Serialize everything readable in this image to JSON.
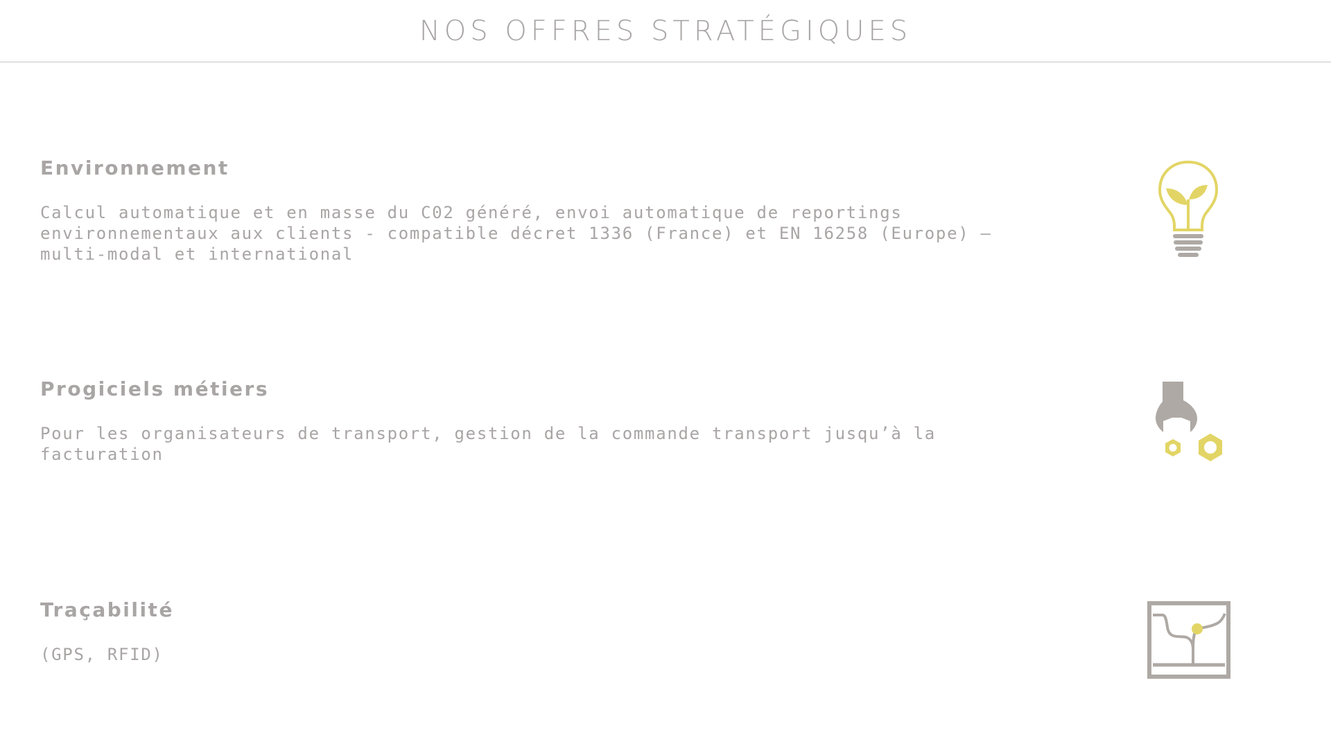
{
  "header": {
    "title": "NOS OFFRES STRATÉGIQUES"
  },
  "sections": [
    {
      "title": "Environnement",
      "description": "Calcul automatique et en masse du C02 généré, envoi automatique de reportings environnementaux aux clients - compatible décret 1336 (France) et EN 16258 (Europe) – multi-modal et international",
      "icon": "lightbulb-plant-icon"
    },
    {
      "title": "Progiciels métiers",
      "description": "Pour les organisateurs de transport, gestion de la commande transport jusqu’à la facturation",
      "icon": "wrench-nuts-icon"
    },
    {
      "title": "Traçabilité",
      "description": "(GPS, RFID)",
      "icon": "map-tracking-icon"
    }
  ],
  "colors": {
    "text_gray": "#a9a5a5",
    "icon_gray": "#aea9a4",
    "accent_yellow": "#e2d565",
    "divider": "#c8c6c6"
  }
}
